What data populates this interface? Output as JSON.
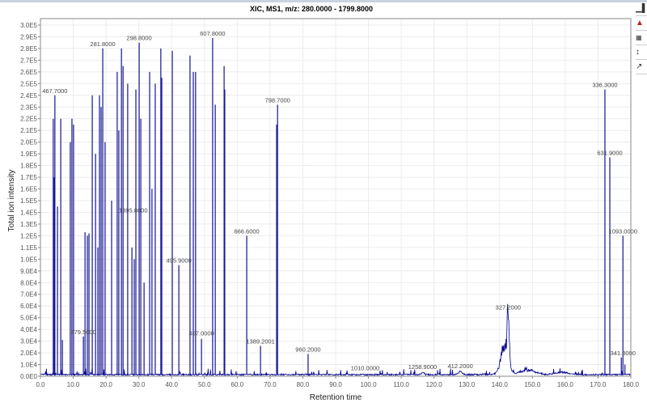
{
  "chart_data": {
    "type": "line",
    "title": "XIC, MS1, m/z: 280.0000 - 1799.8000",
    "xlabel": "Retention time",
    "ylabel": "Total ion intensity",
    "xlim": [
      0,
      180
    ],
    "ylim": [
      0,
      300000
    ],
    "x_ticks": [
      "0.0",
      "10.0",
      "20.0",
      "30.0",
      "40.0",
      "50.0",
      "60.0",
      "70.0",
      "80.0",
      "90.0",
      "100.0",
      "110.0",
      "120.0",
      "130.0",
      "140.0",
      "150.0",
      "160.0",
      "170.0",
      "180.0"
    ],
    "y_ticks": [
      "0.0E0",
      "1.0E4",
      "2.0E4",
      "3.0E4",
      "4.0E4",
      "5.0E4",
      "6.0E4",
      "7.0E4",
      "8.0E4",
      "9.0E4",
      "1.0E5",
      "1.1E5",
      "1.2E5",
      "1.3E5",
      "1.4E5",
      "1.5E5",
      "1.6E5",
      "1.7E5",
      "1.8E5",
      "1.9E5",
      "2.0E5",
      "2.1E5",
      "2.2E5",
      "2.3E5",
      "2.4E5",
      "2.5E5",
      "2.6E5",
      "2.7E5",
      "2.8E5",
      "2.9E5",
      "3.0E5"
    ],
    "grid": true,
    "series_color": "#00008b",
    "peaks": [
      [
        3.9,
        220000
      ],
      [
        4.2,
        170000
      ],
      [
        4.4,
        240000
      ],
      [
        5.2,
        145000
      ],
      [
        6.2,
        220000
      ],
      [
        6.7,
        31000
      ],
      [
        9.1,
        200000
      ],
      [
        9.6,
        220000
      ],
      [
        10.1,
        215000
      ],
      [
        13.1,
        34000
      ],
      [
        13.6,
        123000
      ],
      [
        14.3,
        120000
      ],
      [
        14.8,
        122000
      ],
      [
        15.8,
        240000
      ],
      [
        16.8,
        190000
      ],
      [
        17.5,
        110000
      ],
      [
        18.0,
        240000
      ],
      [
        18.5,
        230000
      ],
      [
        19.0,
        280000
      ],
      [
        19.7,
        200000
      ],
      [
        21.7,
        150000
      ],
      [
        23.4,
        260000
      ],
      [
        23.9,
        210000
      ],
      [
        24.7,
        280000
      ],
      [
        25.2,
        265000
      ],
      [
        26.6,
        250000
      ],
      [
        27.9,
        110000
      ],
      [
        28.6,
        100000
      ],
      [
        29.1,
        245000
      ],
      [
        30.1,
        285000
      ],
      [
        30.6,
        220000
      ],
      [
        31.6,
        80000
      ],
      [
        33.3,
        260000
      ],
      [
        34.0,
        160000
      ],
      [
        35.0,
        250000
      ],
      [
        36.7,
        280000
      ],
      [
        37.0,
        255000
      ],
      [
        40.2,
        278000
      ],
      [
        42.2,
        95000
      ],
      [
        45.6,
        274000
      ],
      [
        46.6,
        260000
      ],
      [
        47.3,
        260000
      ],
      [
        49.1,
        32000
      ],
      [
        52.5,
        289000
      ],
      [
        53.3,
        232000
      ],
      [
        56.0,
        265000
      ],
      [
        56.2,
        245000
      ],
      [
        62.9,
        120000
      ],
      [
        67.1,
        26000
      ],
      [
        72.0,
        215000
      ],
      [
        72.3,
        232000
      ],
      [
        81.6,
        19000
      ],
      [
        172.1,
        245000
      ],
      [
        173.6,
        187000
      ],
      [
        177.1,
        16000
      ],
      [
        177.6,
        120000
      ],
      [
        178.2,
        10000
      ]
    ],
    "humps": [
      {
        "center": 141.5,
        "width": 1.6,
        "height": 30000
      },
      {
        "center": 142.6,
        "width": 0.4,
        "height": 55000
      },
      {
        "center": 148.5,
        "width": 3.0,
        "height": 5000
      },
      {
        "center": 159.0,
        "width": 3.0,
        "height": 2500
      },
      {
        "center": 128.0,
        "width": 0.8,
        "height": 3500
      },
      {
        "center": 116.5,
        "width": 0.6,
        "height": 2500
      }
    ],
    "annotations": [
      {
        "label": "467.7000",
        "x": 4.4,
        "y": 240000
      },
      {
        "label": "281.8000",
        "x": 19.0,
        "y": 280000
      },
      {
        "label": "298.8000",
        "x": 30.1,
        "y": 285000
      },
      {
        "label": "607.8000",
        "x": 52.5,
        "y": 289000
      },
      {
        "label": "798.7000",
        "x": 72.3,
        "y": 232000
      },
      {
        "label": "1395.8000",
        "x": 28.3,
        "y": 138000
      },
      {
        "label": "495.9000",
        "x": 42.2,
        "y": 95000
      },
      {
        "label": "666.6000",
        "x": 62.9,
        "y": 120000
      },
      {
        "label": "379.5000",
        "x": 13.1,
        "y": 34000
      },
      {
        "label": "407.0000",
        "x": 49.1,
        "y": 33000
      },
      {
        "label": "1389.2001",
        "x": 67.1,
        "y": 26000
      },
      {
        "label": "960.2000",
        "x": 81.6,
        "y": 19000
      },
      {
        "label": "1010.0000",
        "x": 99.0,
        "y": 3000
      },
      {
        "label": "1258.9000",
        "x": 116.5,
        "y": 4000
      },
      {
        "label": "412.2000",
        "x": 128.0,
        "y": 5000
      },
      {
        "label": "327.2000",
        "x": 142.6,
        "y": 55000
      },
      {
        "label": "336.3000",
        "x": 172.1,
        "y": 245000
      },
      {
        "label": "631.9000",
        "x": 173.6,
        "y": 187000
      },
      {
        "label": "1093.0000",
        "x": 177.6,
        "y": 120000
      },
      {
        "label": "341.8000",
        "x": 177.6,
        "y": 16000
      }
    ]
  },
  "toolbar": {
    "icons": [
      "show-spectrum-icon",
      "highlight-peaks-icon",
      "toggle-labels-icon",
      "axis-settings-icon",
      "zoom-icon"
    ]
  }
}
